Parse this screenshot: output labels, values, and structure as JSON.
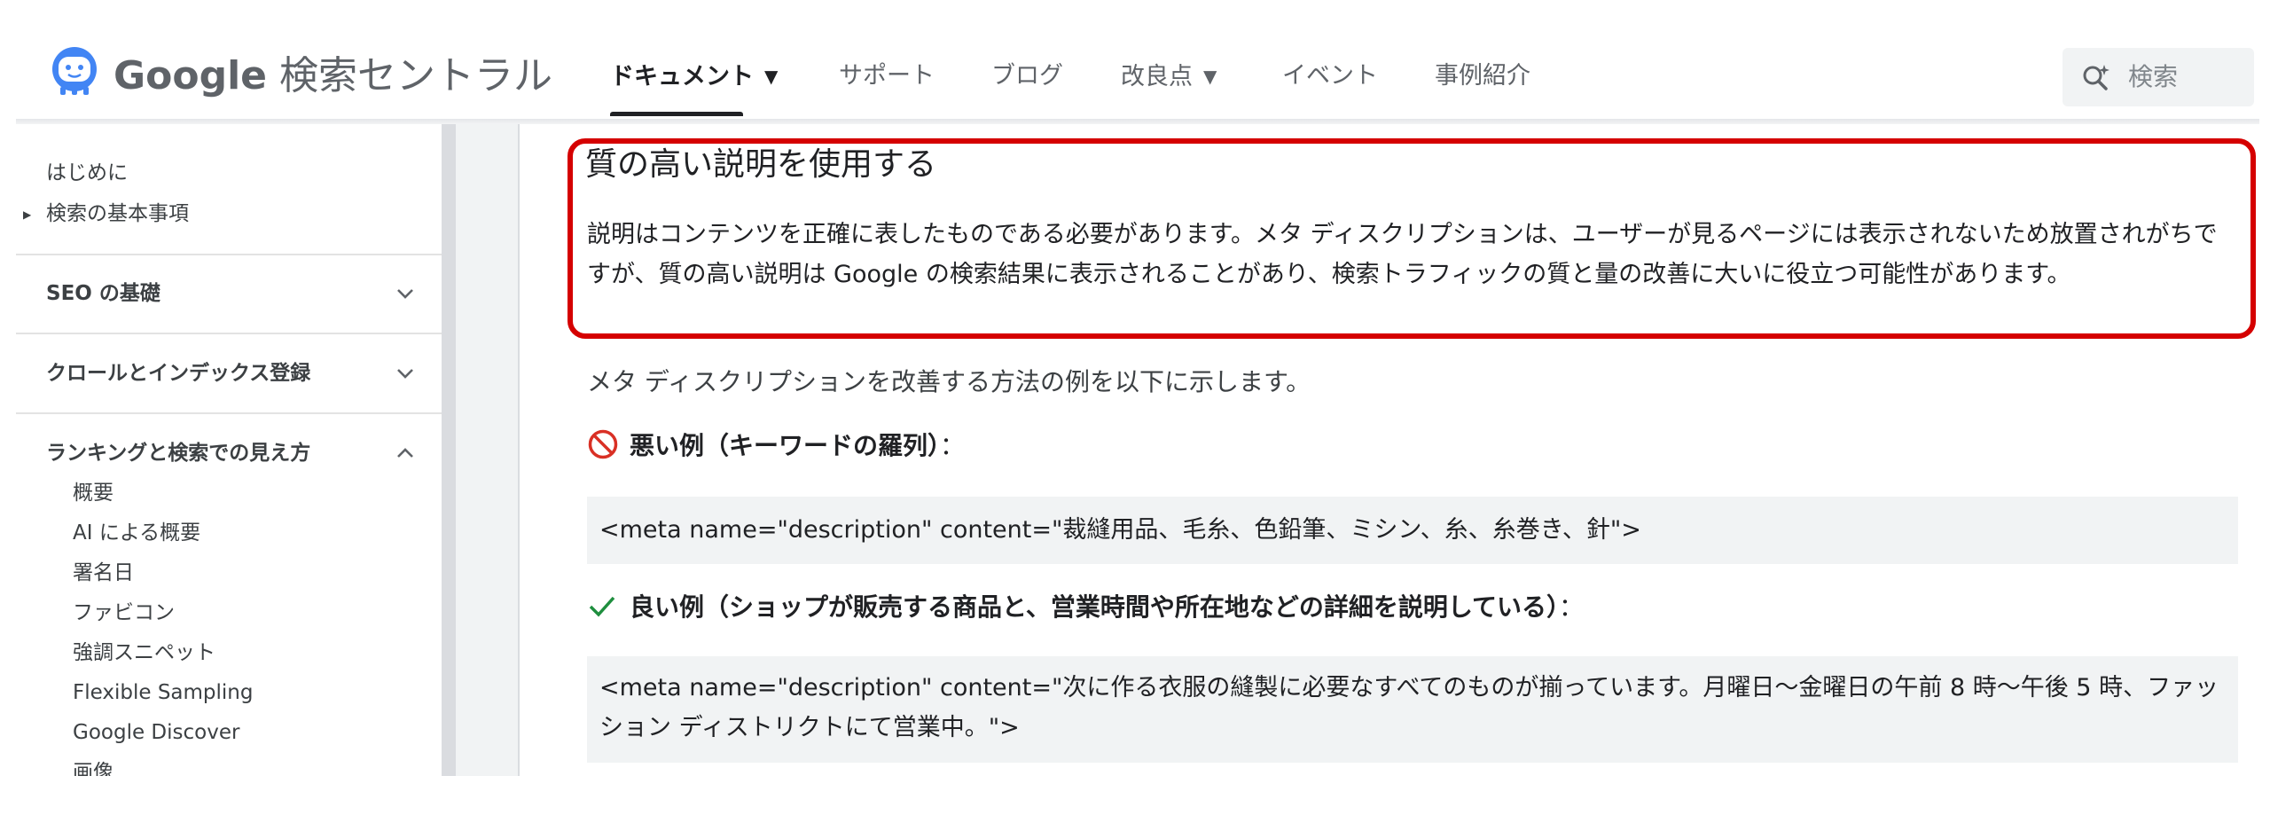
{
  "header": {
    "logo_google": "Google",
    "logo_product": "検索セントラル",
    "tabs": [
      {
        "label": "ドキュメント",
        "active": true,
        "has_dropdown": true
      },
      {
        "label": "サポート"
      },
      {
        "label": "ブログ"
      },
      {
        "label": "改良点",
        "has_dropdown": true
      },
      {
        "label": "イベント"
      },
      {
        "label": "事例紹介"
      }
    ],
    "search_placeholder": "検索"
  },
  "sidebar": {
    "intro": "はじめに",
    "basics": "検索の基本事項",
    "sections": [
      {
        "label": "SEO の基礎",
        "expanded": false
      },
      {
        "label": "クロールとインデックス登録",
        "expanded": false
      },
      {
        "label": "ランキングと検索での見え方",
        "expanded": true
      }
    ],
    "sub_items": [
      "概要",
      "AI による概要",
      "署名日",
      "ファビコン",
      "強調スニペット",
      "Flexible Sampling",
      "Google Discover",
      "画像"
    ]
  },
  "content": {
    "heading": "質の高い説明を使用する",
    "paragraph": "説明はコンテンツを正確に表したものである必要があります。メタ ディスクリプションは、ユーザーが見るページには表示されないため放置されがちですが、質の高い説明は Google の検索結果に表示されることがあり、検索トラフィックの質と量の改善に大いに役立つ可能性があります。",
    "intro": "メタ ディスクリプションを改善する方法の例を以下に示します。",
    "bad_label": "悪い例（キーワードの羅列）",
    "bad_code": "<meta name=\"description\" content=\"裁縫用品、毛糸、色鉛筆、ミシン、糸、糸巻き、針\">",
    "good_label": "良い例（ショップが販売する商品と、営業時間や所在地などの詳細を説明している）",
    "good_code": "<meta name=\"description\" content=\"次に作る衣服の縫製に必要なすべてのものが揃っています。月曜日～金曜日の午前 8 時～午後 5 時、ファッション ディストリクトにて営業中。\">",
    "label_suffix": "：",
    "highlight_color": "#d50000",
    "bad_color": "#d93025",
    "good_color": "#1e8e3e"
  }
}
